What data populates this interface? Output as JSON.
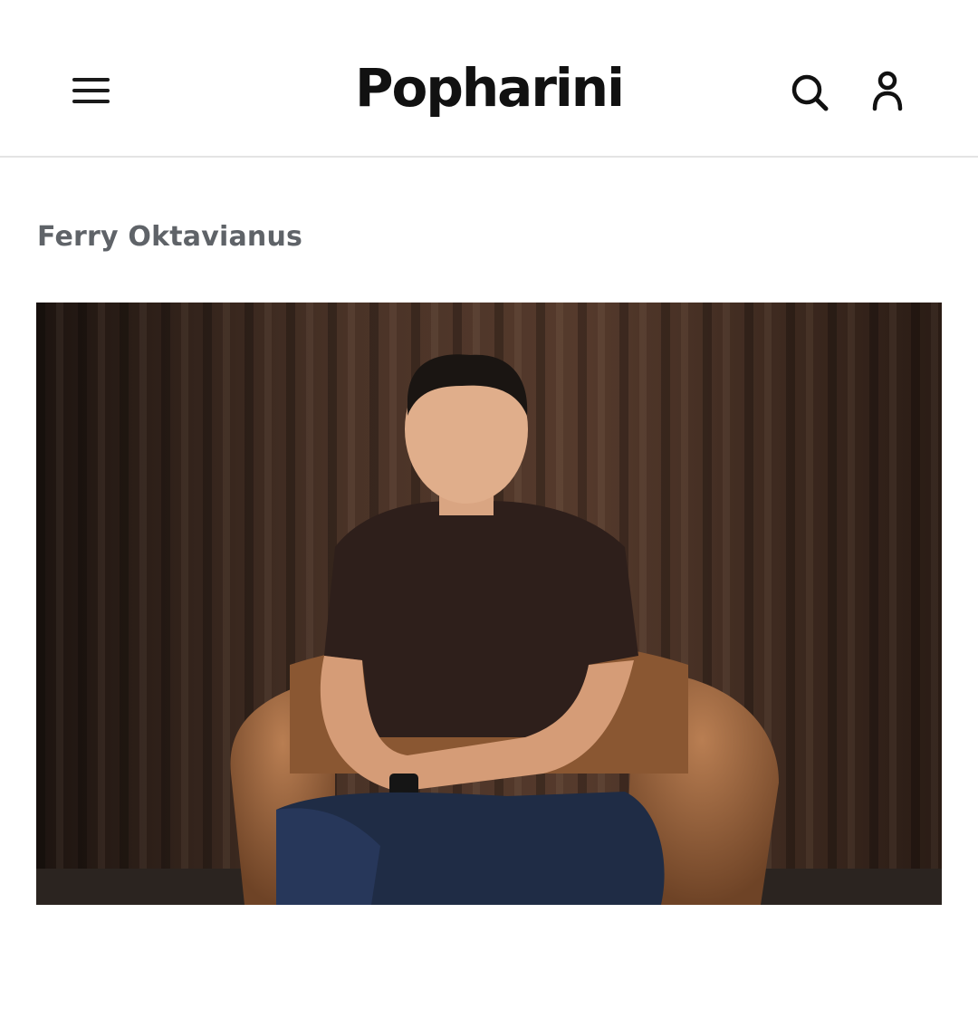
{
  "header": {
    "logo_text": "Popharini",
    "menu_icon": "hamburger-menu-icon",
    "search_icon": "search-icon",
    "account_icon": "user-account-icon"
  },
  "article": {
    "author": "Ferry Oktavianus",
    "image_alt": "Ferry Oktavianus"
  },
  "colors": {
    "header_border": "#e4e4e4",
    "byline": "#5f6368",
    "logo": "#111111"
  }
}
